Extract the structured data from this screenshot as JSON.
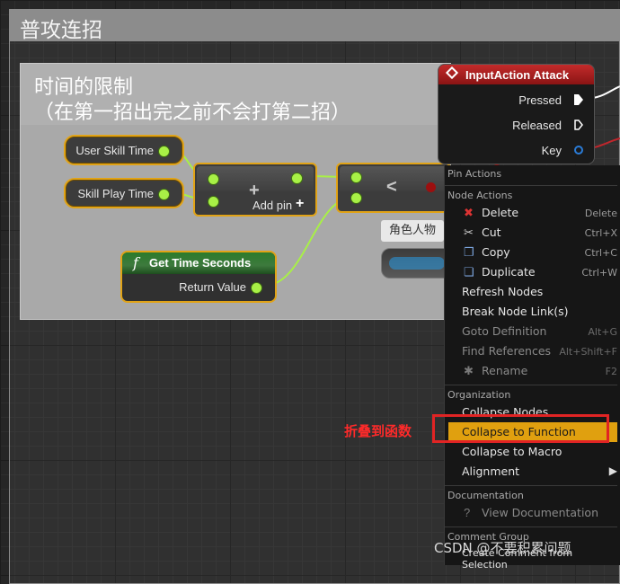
{
  "outer_comment": {
    "title": "普攻连招"
  },
  "inner_comment": {
    "line1": "时间的限制",
    "line2": "（在第一招出完之前不会打第二招）"
  },
  "nodes": {
    "user_skill_time": "User Skill Time",
    "skill_play_time": "Skill Play Time",
    "add": {
      "symbol": "+",
      "add_pin": "Add pin"
    },
    "compare": {
      "symbol": "<"
    },
    "get_time": {
      "title": "Get Time Seconds",
      "return": "Return Value",
      "icon": "function-icon"
    },
    "character": {
      "label": "角色人物"
    },
    "input_action": {
      "title": "InputAction Attack",
      "pressed": "Pressed",
      "released": "Released",
      "key": "Key"
    }
  },
  "context_menu": {
    "sections": {
      "pin_actions": "Pin Actions",
      "node_actions": "Node Actions",
      "organization": "Organization",
      "documentation": "Documentation",
      "comment_group": "Comment Group"
    },
    "node_actions": [
      {
        "label": "Delete",
        "shortcut": "Delete",
        "icon": "delete-icon"
      },
      {
        "label": "Cut",
        "shortcut": "Ctrl+X",
        "icon": "scissors-icon"
      },
      {
        "label": "Copy",
        "shortcut": "Ctrl+C",
        "icon": "copy-icon"
      },
      {
        "label": "Duplicate",
        "shortcut": "Ctrl+W",
        "icon": "duplicate-icon"
      },
      {
        "label": "Refresh Nodes",
        "shortcut": ""
      },
      {
        "label": "Break Node Link(s)",
        "shortcut": ""
      },
      {
        "label": "Goto Definition",
        "shortcut": "Alt+G",
        "disabled": true
      },
      {
        "label": "Find References",
        "shortcut": "Alt+Shift+F",
        "disabled": true
      },
      {
        "label": "Rename",
        "shortcut": "F2",
        "disabled": true,
        "icon": "star-icon"
      }
    ],
    "organization": [
      {
        "label": "Collapse Nodes"
      },
      {
        "label": "Collapse to Function",
        "selected": true
      },
      {
        "label": "Collapse to Macro"
      },
      {
        "label": "Alignment",
        "submenu": true
      }
    ],
    "documentation": [
      {
        "label": "View Documentation",
        "disabled": true,
        "icon": "help-icon"
      }
    ],
    "comment_group": [
      {
        "label": "Create Comment from Selection"
      }
    ]
  },
  "annotation": {
    "red_label": "折叠到函数"
  },
  "watermark": "CSDN @不要积累问题",
  "colors": {
    "highlight": "#e0a00f",
    "annotation_red": "#e12424",
    "float_pin": "#a8f046",
    "exec_header": "#c32b2b"
  }
}
